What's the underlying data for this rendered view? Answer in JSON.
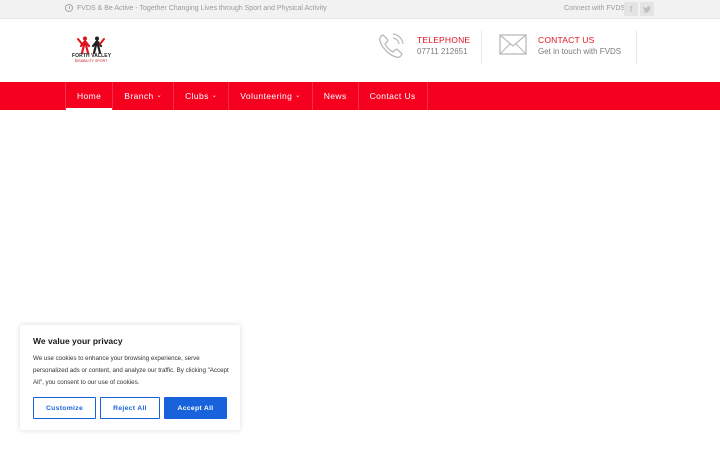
{
  "topbar": {
    "tagline": "FVDS & Be Active - Together Changing Lives through Sport and Physical Activity",
    "connect_label": "Connect with FVDS",
    "social": [
      {
        "icon": "facebook-icon",
        "glyph": "f"
      },
      {
        "icon": "twitter-icon",
        "glyph": "t"
      }
    ]
  },
  "logo": {
    "name": "FORTH VALLEY",
    "subtitle": "DISABILITY SPORT",
    "colors": {
      "red": "#e0141e",
      "dark": "#222222"
    }
  },
  "header": {
    "telephone": {
      "label": "TELEPHONE",
      "value": "07711 212651",
      "icon": "phone-icon"
    },
    "contact": {
      "label": "CONTACT US",
      "value": "Get in touch with FVDS",
      "icon": "envelope-icon"
    }
  },
  "nav": {
    "items": [
      {
        "label": "Home",
        "active": true,
        "dropdown": false
      },
      {
        "label": "Branch",
        "active": false,
        "dropdown": true
      },
      {
        "label": "Clubs",
        "active": false,
        "dropdown": true
      },
      {
        "label": "Volunteering",
        "active": false,
        "dropdown": true
      },
      {
        "label": "News",
        "active": false,
        "dropdown": false
      },
      {
        "label": "Contact Us",
        "active": false,
        "dropdown": false
      }
    ],
    "background": "#f5001f"
  },
  "cookie_banner": {
    "title": "We value your privacy",
    "message": "We use cookies to enhance your browsing experience, serve personalized ads or content, and analyze our traffic. By clicking \"Accept All\", you consent to our use of cookies.",
    "buttons": {
      "customize": "Customize",
      "reject": "Reject All",
      "accept": "Accept All"
    },
    "accent": "#1863dc"
  }
}
